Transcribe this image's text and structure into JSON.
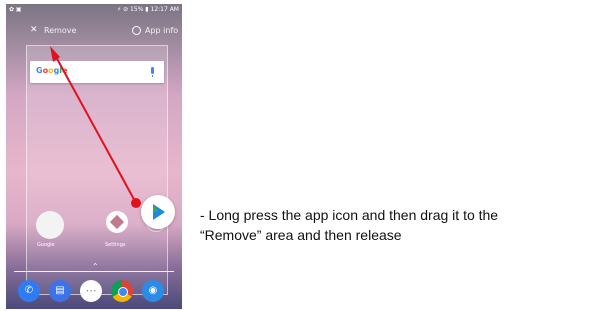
{
  "statusbar": {
    "left_icons": "✿ ▣",
    "right_text": "⚡ ⊘ 15% ▮ 12:17 AM"
  },
  "drop_targets": {
    "remove_label": "Remove",
    "app_info_label": "App info"
  },
  "search": {
    "logo": "Google"
  },
  "home_apps": [
    {
      "name": "Google",
      "label": "Google"
    },
    {
      "name": "Settings",
      "label": "Settings"
    }
  ],
  "dock": {
    "apps": [
      "Phone",
      "Messages",
      "Apps",
      "Chrome",
      "Camera"
    ]
  },
  "annotation": {
    "line1": "- Long press the app icon and then drag it to the",
    "line2": "  “Remove” area and then release"
  },
  "colors": {
    "arrow": "#e2111e",
    "dot": "#e2111e"
  }
}
